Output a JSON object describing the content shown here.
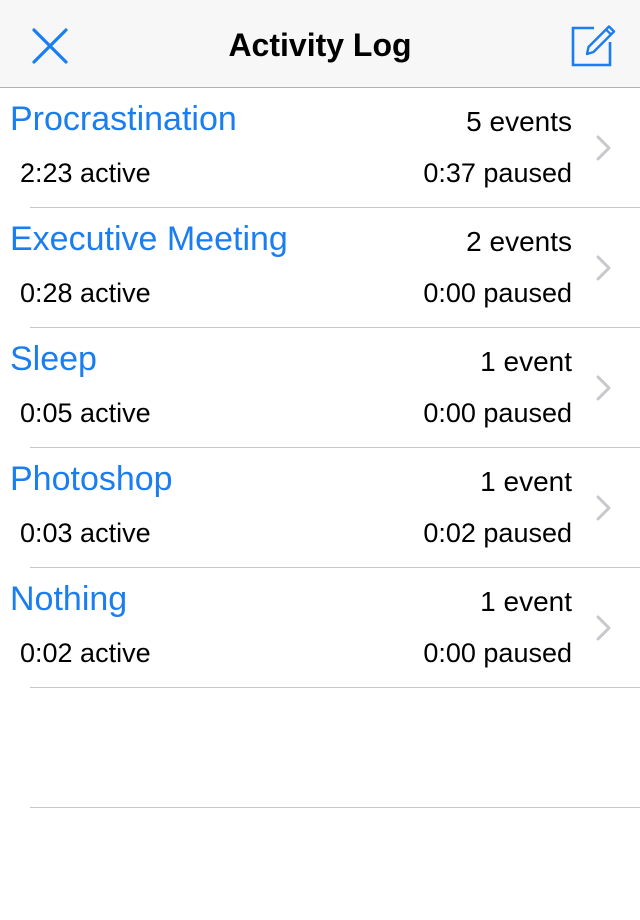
{
  "header": {
    "title": "Activity Log",
    "close_icon": "close-x-icon",
    "compose_icon": "compose-edit-icon",
    "accent_color": "#1a7ef0"
  },
  "activities": [
    {
      "name": "Procrastination",
      "events": "5 events",
      "active": "2:23 active",
      "paused": "0:37 paused"
    },
    {
      "name": "Executive Meeting",
      "events": "2 events",
      "active": "0:28 active",
      "paused": "0:00 paused"
    },
    {
      "name": "Sleep",
      "events": "1 event",
      "active": "0:05 active",
      "paused": "0:00 paused"
    },
    {
      "name": "Photoshop",
      "events": "1 event",
      "active": "0:03 active",
      "paused": "0:02 paused"
    },
    {
      "name": "Nothing",
      "events": "1 event",
      "active": "0:02 active",
      "paused": "0:00 paused"
    }
  ]
}
